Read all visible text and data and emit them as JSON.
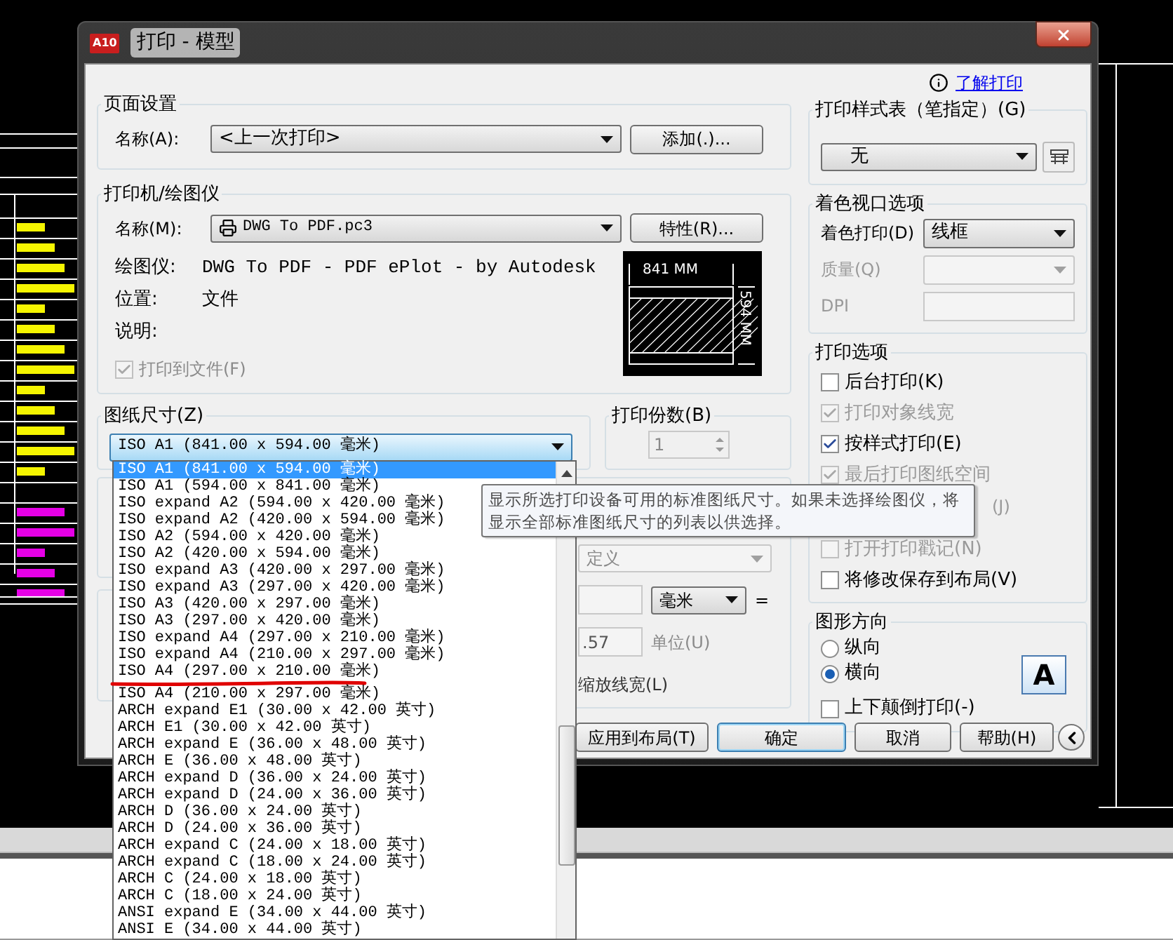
{
  "window": {
    "icon_label": "A10",
    "title": "打印 - 模型"
  },
  "help_link": {
    "text": "了解打印"
  },
  "page_setup": {
    "title": "页面设置",
    "name_label": "名称(A):",
    "name_value": "<上一次打印>",
    "add_button": "添加(.)..."
  },
  "printer": {
    "title": "打印机/绘图仪",
    "name_label": "名称(M):",
    "name_value": "DWG To PDF.pc3",
    "properties_button": "特性(R)...",
    "info": [
      {
        "label": "绘图仪:",
        "value": "DWG To PDF - PDF ePlot - by Autodesk"
      },
      {
        "label": "位置:",
        "value": "文件"
      },
      {
        "label": "说明:"
      }
    ],
    "print_to_file": {
      "label": "打印到文件(F)",
      "checked": true,
      "disabled": true
    },
    "preview": {
      "width_label": "841 MM",
      "height_label": "594 MM"
    }
  },
  "paper_size": {
    "title": "图纸尺寸(Z)",
    "value": "ISO A1 (841.00 x 594.00 毫米)",
    "options": [
      {
        "label": "ISO A1 (841.00 x 594.00 毫米)",
        "selected": true,
        "underlined": false
      },
      {
        "label": "ISO A1 (594.00 x 841.00 毫米)",
        "selected": false,
        "underlined": false
      },
      {
        "label": "ISO expand A2 (594.00 x 420.00 毫米)",
        "selected": false,
        "underlined": false
      },
      {
        "label": "ISO expand A2 (420.00 x 594.00 毫米)",
        "selected": false,
        "underlined": false
      },
      {
        "label": "ISO A2 (594.00 x 420.00 毫米)",
        "selected": false,
        "underlined": false
      },
      {
        "label": "ISO A2 (420.00 x 594.00 毫米)",
        "selected": false,
        "underlined": false
      },
      {
        "label": "ISO expand A3 (420.00 x 297.00 毫米)",
        "selected": false,
        "underlined": false
      },
      {
        "label": "ISO expand A3 (297.00 x 420.00 毫米)",
        "selected": false,
        "underlined": false
      },
      {
        "label": "ISO A3 (420.00 x 297.00 毫米)",
        "selected": false,
        "underlined": false
      },
      {
        "label": "ISO A3 (297.00 x 420.00 毫米)",
        "selected": false,
        "underlined": false
      },
      {
        "label": "ISO expand A4 (297.00 x 210.00 毫米)",
        "selected": false,
        "underlined": false
      },
      {
        "label": "ISO expand A4 (210.00 x 297.00 毫米)",
        "selected": false,
        "underlined": false
      },
      {
        "label": "ISO A4 (297.00 x 210.00 毫米)",
        "selected": false,
        "underlined": true
      },
      {
        "label": "ISO A4 (210.00 x 297.00 毫米)",
        "selected": false,
        "underlined": false
      },
      {
        "label": "ARCH expand E1 (30.00 x 42.00 英寸)",
        "selected": false,
        "underlined": false
      },
      {
        "label": "ARCH E1 (30.00 x 42.00 英寸)",
        "selected": false,
        "underlined": false
      },
      {
        "label": "ARCH expand E (36.00 x 48.00 英寸)",
        "selected": false,
        "underlined": false
      },
      {
        "label": "ARCH E (36.00 x 48.00 英寸)",
        "selected": false,
        "underlined": false
      },
      {
        "label": "ARCH expand D (36.00 x 24.00 英寸)",
        "selected": false,
        "underlined": false
      },
      {
        "label": "ARCH expand D (24.00 x 36.00 英寸)",
        "selected": false,
        "underlined": false
      },
      {
        "label": "ARCH D (36.00 x 24.00 英寸)",
        "selected": false,
        "underlined": false
      },
      {
        "label": "ARCH D (24.00 x 36.00 英寸)",
        "selected": false,
        "underlined": false
      },
      {
        "label": "ARCH expand C (24.00 x 18.00 英寸)",
        "selected": false,
        "underlined": false
      },
      {
        "label": "ARCH expand C (18.00 x 24.00 英寸)",
        "selected": false,
        "underlined": false
      },
      {
        "label": "ARCH C (24.00 x 18.00 英寸)",
        "selected": false,
        "underlined": false
      },
      {
        "label": "ARCH C (18.00 x 24.00 英寸)",
        "selected": false,
        "underlined": false
      },
      {
        "label": "ANSI expand E (34.00 x 44.00 英寸)",
        "selected": false,
        "underlined": false
      },
      {
        "label": "ANSI E (34.00 x 44.00 英寸)",
        "selected": false,
        "underlined": false
      }
    ]
  },
  "copies": {
    "title": "打印份数(B)",
    "value": "1",
    "disabled": true
  },
  "scale": {
    "fit_value": "定义",
    "unit_value": "毫米",
    "equals": "=",
    "units_value": ".57",
    "units_label": "单位(U)",
    "lineweight_label": "缩放线宽(L)"
  },
  "buttons": [
    {
      "label": "应用到布局(T)",
      "default": false
    },
    {
      "label": "确定",
      "default": true
    },
    {
      "label": "取消",
      "default": false
    },
    {
      "label": "帮助(H)",
      "default": false
    }
  ],
  "plot_style": {
    "title": "打印样式表（笔指定）(G)",
    "value": "无"
  },
  "shaded": {
    "title": "着色视口选项",
    "rows": [
      {
        "label": "着色打印(D)",
        "kind": "select",
        "value": "线框",
        "disabled": false
      },
      {
        "label": "质量(Q)",
        "kind": "select",
        "disabled": true
      },
      {
        "label": "DPI",
        "kind": "field",
        "disabled": true
      }
    ]
  },
  "options": {
    "title": "打印选项",
    "items": [
      {
        "kind": "checkbox",
        "label": "后台打印(K)",
        "checked": false,
        "disabled": false
      },
      {
        "kind": "checkbox",
        "label": "打印对象线宽",
        "checked": true,
        "disabled": true
      },
      {
        "kind": "checkbox",
        "label": "按样式打印(E)",
        "checked": true,
        "disabled": false
      },
      {
        "kind": "checkbox",
        "label": "最后打印图纸空间",
        "checked": true,
        "disabled": true
      },
      {
        "kind": "covered",
        "label": "(J)"
      },
      {
        "kind": "checkbox",
        "label": "打开打印戳记(N)",
        "checked": false,
        "disabled": true
      },
      {
        "kind": "checkbox",
        "label": "将修改保存到布局(V)",
        "checked": false,
        "disabled": false
      }
    ]
  },
  "orientation": {
    "title": "图形方向",
    "radios": [
      {
        "label": "纵向",
        "selected": false
      },
      {
        "label": "横向",
        "selected": true
      }
    ],
    "upside_down": {
      "label": "上下颠倒打印(-)",
      "checked": false
    },
    "icon_letter": "A"
  },
  "tooltip": {
    "text": "显示所选打印设备可用的标准图纸尺寸。如果未选择绘图仪，将显示全部标准图纸尺寸的列表以供选择。"
  }
}
